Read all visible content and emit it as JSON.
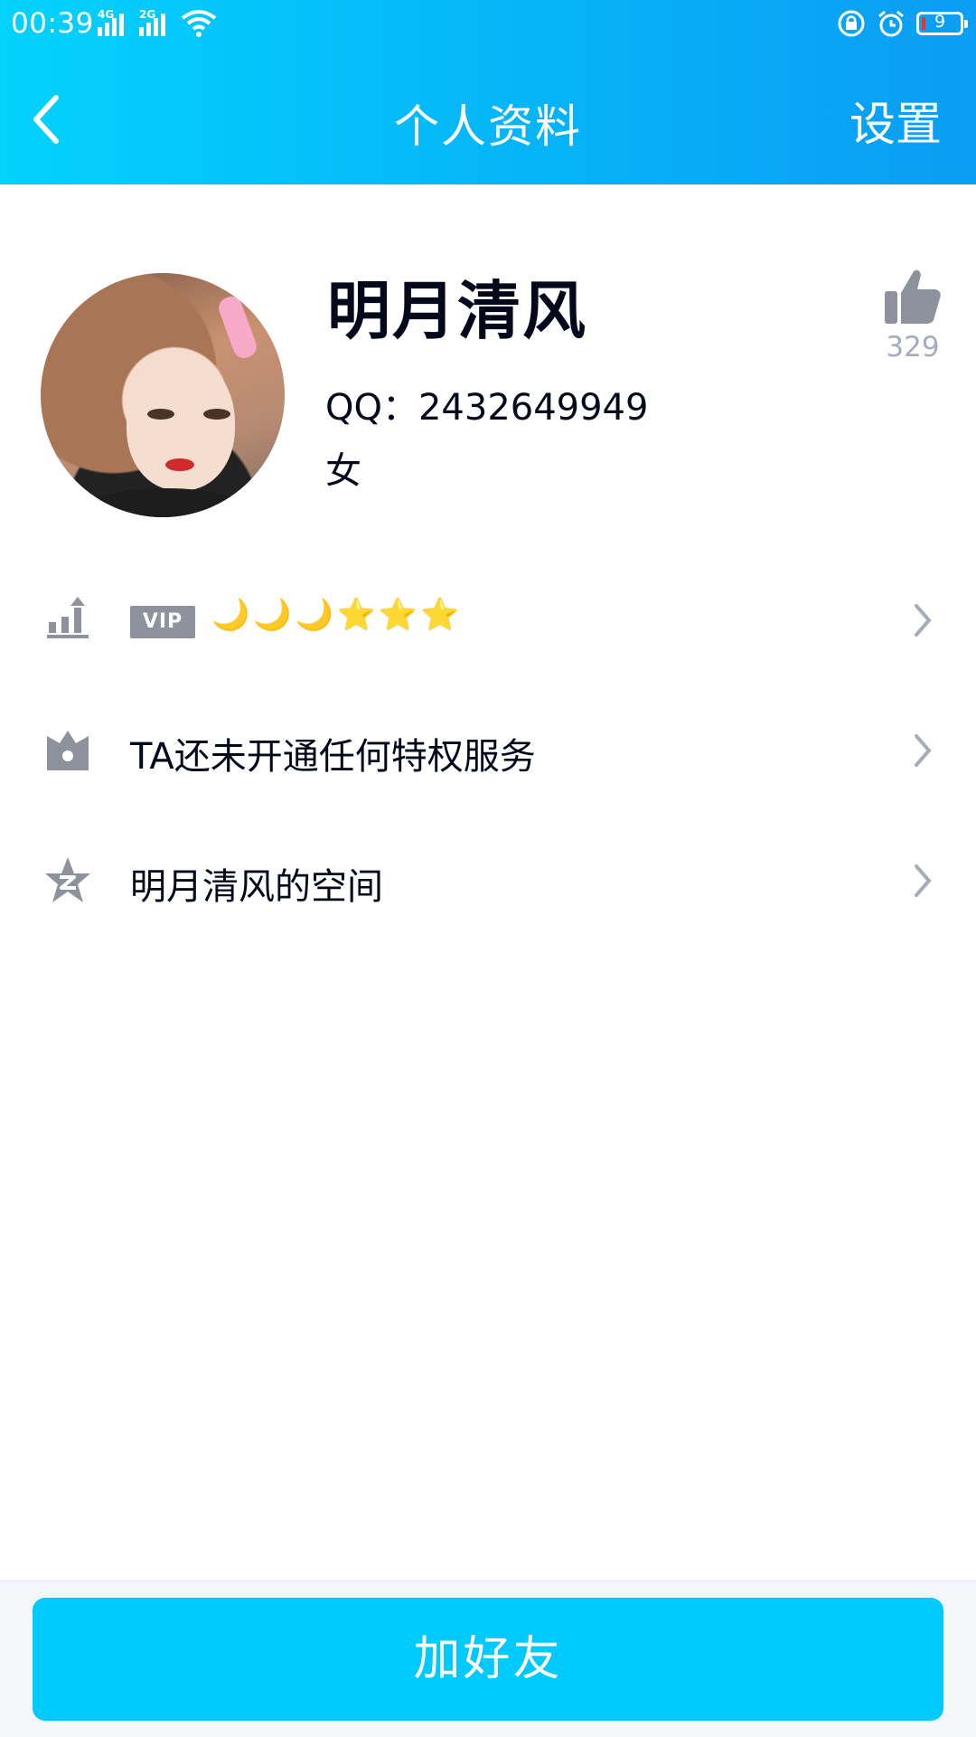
{
  "status_bar": {
    "time": "00:39",
    "signal1_tag": "4G",
    "signal2_tag": "2G",
    "battery": "9"
  },
  "nav": {
    "title": "个人资料",
    "settings": "设置"
  },
  "profile": {
    "name": "明月清风",
    "qq": "QQ：2432649949",
    "gender": "女",
    "likes": "329"
  },
  "rows": {
    "vip_label": "VIP",
    "levels": [
      "🌙",
      "🌙",
      "🌙",
      "⭐",
      "⭐",
      "⭐"
    ],
    "privilege": "TA还未开通任何特权服务",
    "space": "明月清风的空间"
  },
  "bottom": {
    "add_friend": "加好友"
  },
  "colors": {
    "header_start": "#03d2fc",
    "header_end": "#0b9df3",
    "button": "#00cafc",
    "icon_gray": "#8d929d"
  }
}
